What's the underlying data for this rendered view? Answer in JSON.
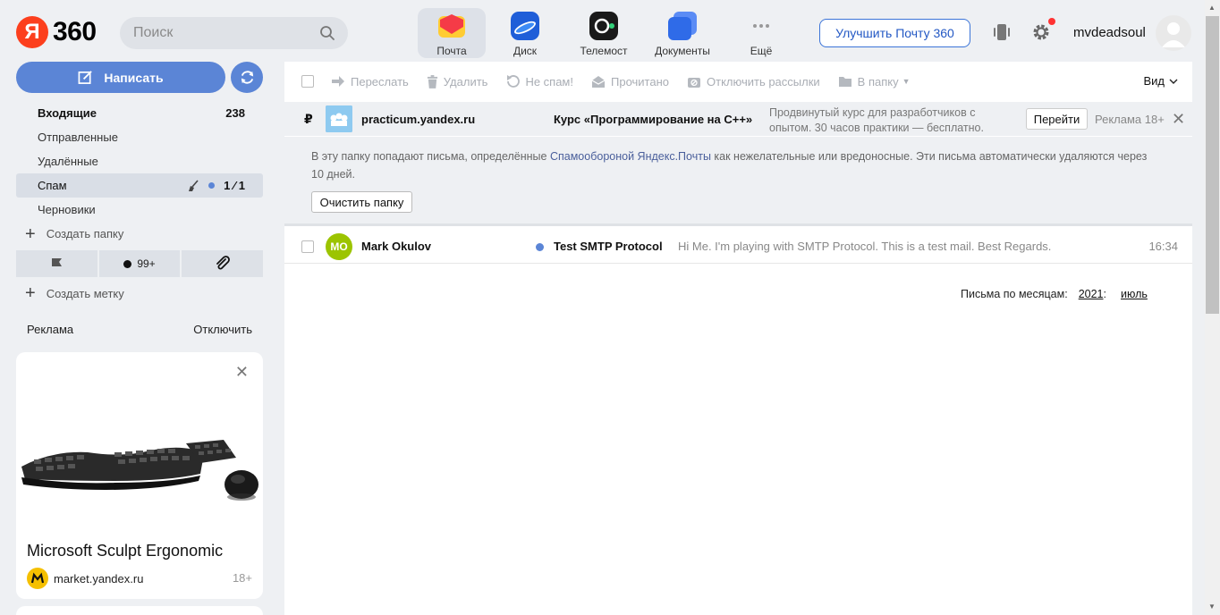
{
  "header": {
    "logo_letter": "Я",
    "logo_text": "360",
    "search_placeholder": "Поиск",
    "services": [
      {
        "label": "Почта",
        "icon": "mail-icon",
        "active": true
      },
      {
        "label": "Диск",
        "icon": "disk-icon"
      },
      {
        "label": "Телемост",
        "icon": "telemost-icon"
      },
      {
        "label": "Документы",
        "icon": "documents-icon"
      },
      {
        "label": "Ещё",
        "icon": "more-icon"
      }
    ],
    "upgrade_label": "Улучшить Почту 360",
    "username": "mvdeadsoul"
  },
  "sidebar": {
    "compose_label": "Написать",
    "folders": [
      {
        "label": "Входящие",
        "count": "238"
      },
      {
        "label": "Отправленные"
      },
      {
        "label": "Удалённые"
      },
      {
        "label": "Спам",
        "count": "1 ⁄ 1"
      },
      {
        "label": "Черновики"
      }
    ],
    "create_folder_label": "Создать папку",
    "filters": {
      "unread_count": "99+"
    },
    "create_label_label": "Создать метку",
    "ad": {
      "header_label": "Реклама",
      "disable_label": "Отключить",
      "title": "Microsoft Sculpt Ergonomic",
      "source": "market.yandex.ru",
      "age": "18+"
    }
  },
  "toolbar": {
    "forward": "Переслать",
    "delete": "Удалить",
    "not_spam": "Не спам!",
    "read": "Прочитано",
    "unsubscribe": "Отключить рассылки",
    "to_folder": "В папку",
    "view": "Вид"
  },
  "ad_row": {
    "currency": "₽",
    "domain": "practicum.yandex.ru",
    "course": "Курс «Программирование на C++»",
    "description": "Продвинутый курс для разработчиков с опытом. 30 часов практики — бесплатно.",
    "go_label": "Перейти",
    "age_label": "Реклама 18+"
  },
  "spam_info": {
    "text_before": "В эту папку попадают письма, определённые ",
    "link_text": "Спамообороной Яндекс.Почты",
    "text_after": " как нежелательные или вредоносные. Эти письма автоматически удаляются через 10 дней.",
    "clear_label": "Очистить папку"
  },
  "messages": [
    {
      "initials": "MO",
      "sender": "Mark Okulov",
      "subject": "Test SMTP Protocol",
      "snippet": "Hi Me. I'm playing with SMTP Protocol. This is a test mail. Best Regards.",
      "time": "16:34"
    }
  ],
  "months": {
    "label": "Письма по месяцам:",
    "year": "2021",
    "separator": ":",
    "month": "июль"
  },
  "colors": {
    "accent": "#5b85d6",
    "logo_red": "#fc3f1d",
    "avatar_green": "#9cc400"
  }
}
